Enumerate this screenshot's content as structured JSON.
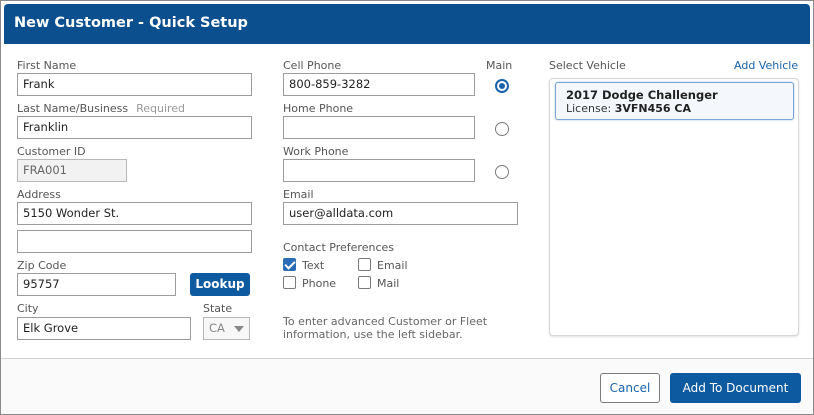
{
  "title": "New Customer - Quick Setup",
  "fields": {
    "first_name": {
      "label": "First Name",
      "value": "Frank"
    },
    "last_name": {
      "label": "Last Name/Business",
      "required": "Required",
      "value": "Franklin"
    },
    "customer_id": {
      "label": "Customer ID",
      "value": "FRA001"
    },
    "address": {
      "label": "Address",
      "line1": "5150 Wonder St.",
      "line2": ""
    },
    "zip": {
      "label": "Zip Code",
      "value": "95757",
      "lookup": "Lookup"
    },
    "city": {
      "label": "City",
      "value": "Elk Grove"
    },
    "state": {
      "label": "State",
      "value": "CA"
    }
  },
  "phones": {
    "main_label": "Main",
    "cell": {
      "label": "Cell Phone",
      "value": "800-859-3282",
      "main": true
    },
    "home": {
      "label": "Home Phone",
      "value": "",
      "main": false
    },
    "work": {
      "label": "Work Phone",
      "value": "",
      "main": false
    }
  },
  "email": {
    "label": "Email",
    "value": "user@alldata.com"
  },
  "contact_prefs": {
    "label": "Contact Preferences",
    "options": [
      {
        "label": "Text",
        "checked": true
      },
      {
        "label": "Email",
        "checked": false
      },
      {
        "label": "Phone",
        "checked": false
      },
      {
        "label": "Mail",
        "checked": false
      }
    ]
  },
  "hint": "To enter advanced Customer or Fleet information, use the left sidebar.",
  "vehicle": {
    "label": "Select Vehicle",
    "add_label": "Add Vehicle",
    "items": [
      {
        "name": "2017 Dodge Challenger",
        "license_label": "License:",
        "license": "3VFN456 CA"
      }
    ]
  },
  "footer": {
    "cancel": "Cancel",
    "add": "Add To Document"
  },
  "colors": {
    "header": "#0b4f8f",
    "primary": "#0e5aa0",
    "link": "#1a63ab"
  }
}
